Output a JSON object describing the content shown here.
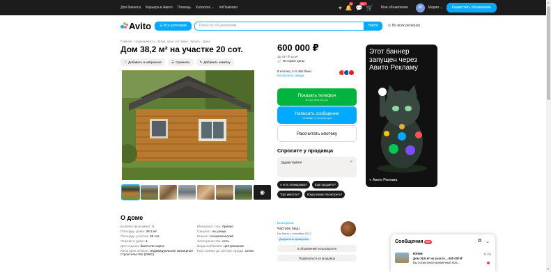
{
  "topbar": {
    "links": [
      "Для бизнеса",
      "Карьера в Авито",
      "Помощь",
      "Каталоги ⌄",
      "#яПомогаю"
    ],
    "badges": {
      "notifications": "3",
      "messages": "99+"
    },
    "my_ads": "Мои объявления",
    "user_initial": "M",
    "user_name": "Мария ⌄",
    "post_button": "Разместить объявление"
  },
  "header": {
    "logo": "Avito",
    "categories_button": "☰ Все категории",
    "search_placeholder": "Поиск по объявлениям",
    "find_button": "Найти",
    "region": "Во всех регионах"
  },
  "breadcrumbs": "Главная · Недвижимость · Дома, дачи, коттеджи · Купить · Дома",
  "listing": {
    "title": "Дом 38,2 м² на участке 20 сот.",
    "actions": [
      "Добавить в избранное",
      "Сравнить",
      "Добавить заметку"
    ],
    "price": "600 000 ₽",
    "price_per_m": "15 707 ₽ за м²",
    "price_history": "История цены",
    "mortgage_line": "В ипотеку от 8 489 ₽/мес.",
    "mortgage_link": "Посмотреть скидки",
    "call_button": "Показать телефон",
    "call_number": "8 XXX XXX-XX-XX",
    "message_button": "Написать сообщение",
    "message_sub": "Отвечает в течение дня",
    "mortgage_button": "Рассчитать ипотеку"
  },
  "ask": {
    "heading": "Спросите у продавца",
    "message": "Здравствуйте!",
    "chips": [
      "А есть планировка?",
      "Ещё продаёте?",
      "Торг уместен?",
      "Когда можно посмотреть?"
    ]
  },
  "about": {
    "heading": "О доме",
    "params_left": [
      {
        "label": "Количество комнат:",
        "value": "2"
      },
      {
        "label": "Площадь дома:",
        "value": "38.2 м²"
      },
      {
        "label": "Площадь участка:",
        "value": "20 сот."
      },
      {
        "label": "Этажей в доме:",
        "value": "1"
      },
      {
        "label": "Для отдыха:",
        "value": "баня или сауна"
      },
      {
        "label": "Категория земель:",
        "value": "индивидуальное жилищное строительство (ИЖС)"
      }
    ],
    "params_right": [
      {
        "label": "Материал стен:",
        "value": "бревно"
      },
      {
        "label": "Санузел:",
        "value": "на улице"
      },
      {
        "label": "Ремонт:",
        "value": "косметический"
      },
      {
        "label": "Электричество:",
        "value": "есть"
      },
      {
        "label": "Водоснабжение:",
        "value": "центральное"
      },
      {
        "label": "Расстояние до центра города:",
        "value": "14 км"
      }
    ]
  },
  "seller": {
    "name": "Екатерина",
    "type": "Частное лицо",
    "since": "На Авито с сентября 2012",
    "badge": "Документы проверены",
    "ads_button": "6 объявлений пользователя",
    "subscribe_button": "Подписаться на продавца"
  },
  "ad": {
    "text": "Этот баннер запущен через Авито Рекламу",
    "footer": "Авито Реклама"
  },
  "messages": {
    "heading": "Сообщения",
    "badge": "99+",
    "item": {
      "name": "Юлия",
      "time": "11:06",
      "line1": "Дом 36,6 м² на участк… 600 000 ₽",
      "line2": "Вы посмотрели временный ном…"
    }
  },
  "colors": {
    "accent": "#00aaff",
    "green": "#00b43e",
    "dark": "#1c1c1c",
    "badge": "#f73b4b"
  }
}
